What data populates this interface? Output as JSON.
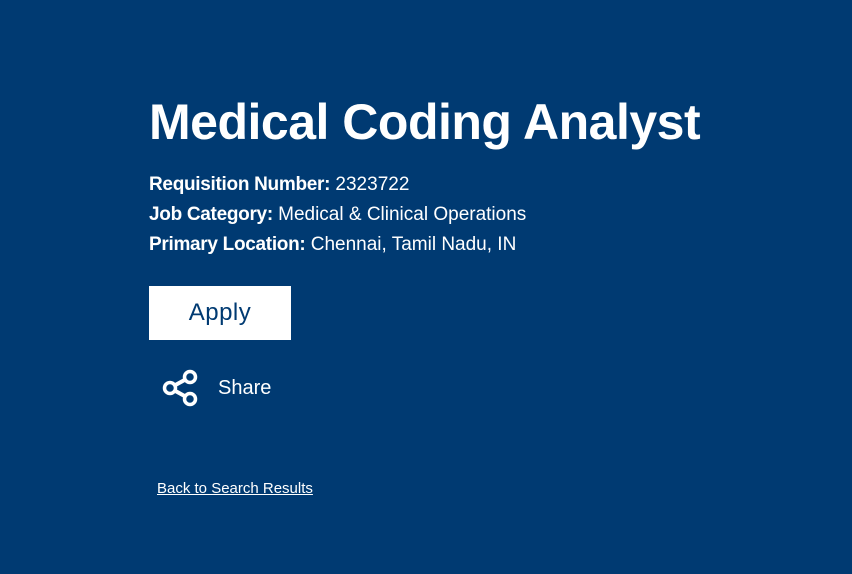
{
  "job": {
    "title": "Medical Coding Analyst",
    "requisition_label": "Requisition Number:",
    "requisition_value": "2323722",
    "category_label": "Job Category:",
    "category_value": "Medical & Clinical Operations",
    "location_label": "Primary Location:",
    "location_value": "Chennai, Tamil Nadu, IN"
  },
  "actions": {
    "apply_label": "Apply",
    "share_label": "Share",
    "share_icon": "share-icon",
    "back_label": "Back to Search Results"
  },
  "colors": {
    "background": "#003a72",
    "text": "#ffffff",
    "button_bg": "#ffffff",
    "button_text": "#003a72"
  }
}
